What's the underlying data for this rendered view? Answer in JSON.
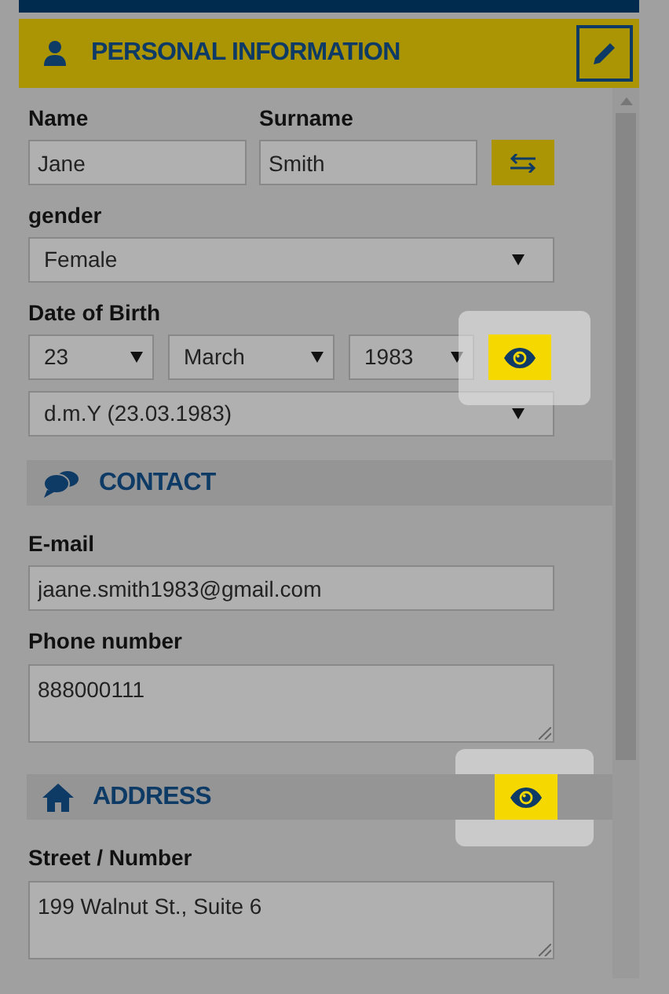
{
  "header": {
    "title": "PERSONAL INFORMATION"
  },
  "name": {
    "label": "Name",
    "value": "Jane"
  },
  "surname": {
    "label": "Surname",
    "value": "Smith"
  },
  "gender": {
    "label": "gender",
    "value": "Female"
  },
  "date_of_birth": {
    "label": "Date of Birth",
    "day": "23",
    "month": "March",
    "year": "1983",
    "format": "d.m.Y (23.03.1983)",
    "highlighted": true
  },
  "contact": {
    "title": "CONTACT",
    "email": {
      "label": "E-mail",
      "value": "jaane.smith1983@gmail.com"
    },
    "phone": {
      "label": "Phone number",
      "value": "888000111"
    }
  },
  "address": {
    "title": "ADDRESS",
    "highlighted": true,
    "street": {
      "label": "Street / Number",
      "value": "199 Walnut St., Suite 6"
    }
  }
}
